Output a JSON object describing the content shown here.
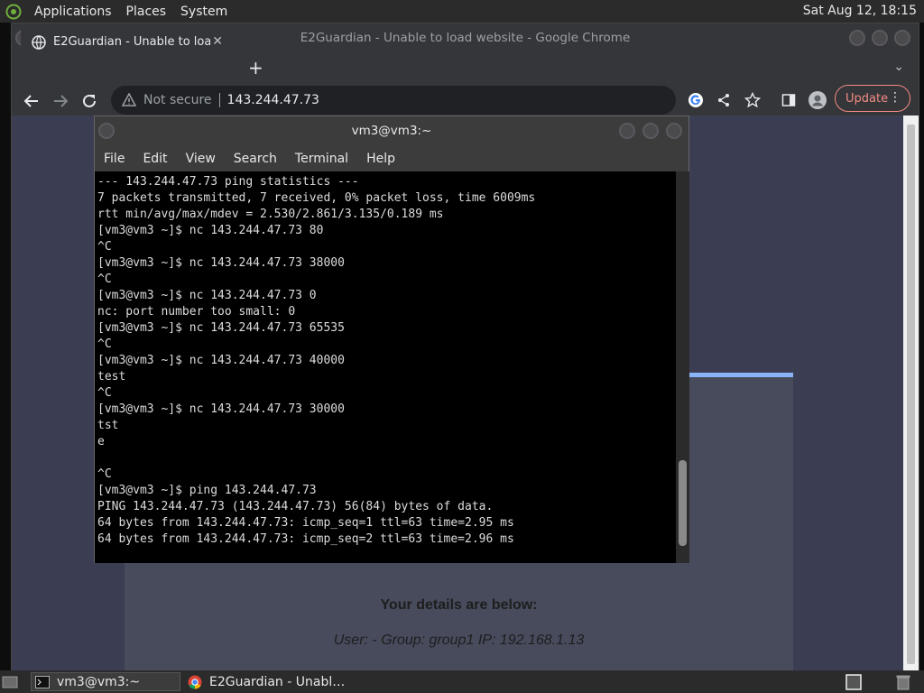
{
  "top_panel": {
    "menus": [
      "Applications",
      "Places",
      "System"
    ],
    "clock": "Sat Aug 12, 18:15"
  },
  "chrome": {
    "window_title": "E2Guardian - Unable to load website - Google Chrome",
    "tab_title": "E2Guardian - Unable to load w",
    "not_secure": "Not secure",
    "url": "143.244.47.73",
    "update_label": "Update",
    "page": {
      "details_title": "Your details are below:",
      "details_line": "User: -   Group: group1   IP: 192.168.1.13"
    }
  },
  "terminal": {
    "title": "vm3@vm3:~",
    "menus": [
      "File",
      "Edit",
      "View",
      "Search",
      "Terminal",
      "Help"
    ],
    "lines": [
      "--- 143.244.47.73 ping statistics ---",
      "7 packets transmitted, 7 received, 0% packet loss, time 6009ms",
      "rtt min/avg/max/mdev = 2.530/2.861/3.135/0.189 ms",
      "[vm3@vm3 ~]$ nc 143.244.47.73 80",
      "^C",
      "[vm3@vm3 ~]$ nc 143.244.47.73 38000",
      "^C",
      "[vm3@vm3 ~]$ nc 143.244.47.73 0",
      "nc: port number too small: 0",
      "[vm3@vm3 ~]$ nc 143.244.47.73 65535",
      "^C",
      "[vm3@vm3 ~]$ nc 143.244.47.73 40000",
      "test",
      "^C",
      "[vm3@vm3 ~]$ nc 143.244.47.73 30000",
      "tst",
      "e",
      "",
      "^C",
      "[vm3@vm3 ~]$ ping 143.244.47.73",
      "PING 143.244.47.73 (143.244.47.73) 56(84) bytes of data.",
      "64 bytes from 143.244.47.73: icmp_seq=1 ttl=63 time=2.95 ms",
      "64 bytes from 143.244.47.73: icmp_seq=2 ttl=63 time=2.96 ms"
    ]
  },
  "bottom_panel": {
    "tasks": [
      "vm3@vm3:~",
      "E2Guardian - Unabl…"
    ]
  },
  "colors": {
    "update_accent": "#f28b82",
    "page_background": "#3b3d52",
    "card_accent": "#8ab4f8"
  }
}
